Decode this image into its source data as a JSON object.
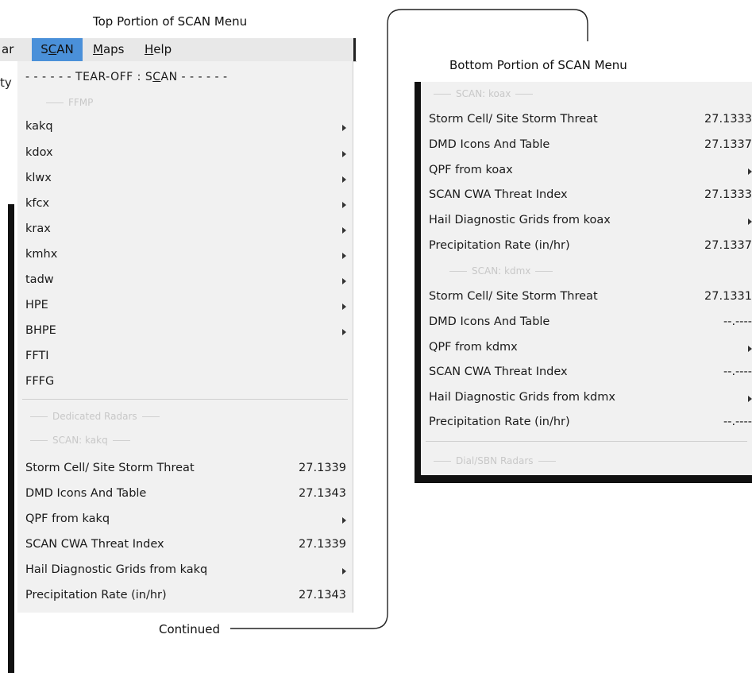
{
  "captions": {
    "top": "Top Portion of SCAN Menu",
    "bottom": "Bottom Portion of SCAN Menu",
    "continued": "Continued"
  },
  "menubar": {
    "partial": "ar",
    "scan": "SCAN",
    "maps": "Maps",
    "help": "Help"
  },
  "left_strip_text": "ty",
  "top_menu": {
    "tearoff": "- - - - - - TEAR-OFF : SCAN - - - - - -",
    "ffmp_header": "FFMP",
    "submenus": [
      {
        "label": "kakq"
      },
      {
        "label": "kdox"
      },
      {
        "label": "klwx"
      },
      {
        "label": "kfcx"
      },
      {
        "label": "krax"
      },
      {
        "label": "kmhx"
      },
      {
        "label": "tadw"
      },
      {
        "label": "HPE"
      },
      {
        "label": "BHPE"
      }
    ],
    "plain": [
      "FFTI",
      "FFFG"
    ],
    "dedicated_header": "Dedicated Radars",
    "scan_kakq_header": "SCAN: kakq",
    "items": [
      {
        "label": "Storm Cell/ Site Storm Threat",
        "value": "27.1339",
        "submenu": false
      },
      {
        "label": "DMD Icons And Table",
        "value": "27.1343",
        "submenu": false
      },
      {
        "label": "QPF from kakq",
        "value": "",
        "submenu": true
      },
      {
        "label": "SCAN CWA Threat Index",
        "value": "27.1339",
        "submenu": false
      },
      {
        "label": "Hail Diagnostic Grids from kakq",
        "value": "",
        "submenu": true
      },
      {
        "label": "Precipitation Rate (in/hr)",
        "value": "27.1343",
        "submenu": false
      }
    ]
  },
  "bottom_menu": {
    "scan_koax_header": "SCAN: koax",
    "koax_items": [
      {
        "label": "Storm Cell/ Site Storm Threat",
        "value": "27.1333",
        "submenu": false
      },
      {
        "label": "DMD Icons And Table",
        "value": "27.1337",
        "submenu": false
      },
      {
        "label": "QPF from koax",
        "value": "",
        "submenu": true
      },
      {
        "label": "SCAN CWA Threat Index",
        "value": "27.1333",
        "submenu": false
      },
      {
        "label": "Hail Diagnostic Grids from koax",
        "value": "",
        "submenu": true
      },
      {
        "label": "Precipitation Rate (in/hr)",
        "value": "27.1337",
        "submenu": false
      }
    ],
    "scan_kdmx_header": "SCAN: kdmx",
    "kdmx_items": [
      {
        "label": "Storm Cell/ Site Storm Threat",
        "value": "27.1331",
        "submenu": false
      },
      {
        "label": "DMD Icons And Table",
        "value": "--.----",
        "submenu": false
      },
      {
        "label": "QPF from kdmx",
        "value": "",
        "submenu": true
      },
      {
        "label": "SCAN CWA Threat Index",
        "value": "--.----",
        "submenu": false
      },
      {
        "label": "Hail Diagnostic Grids from kdmx",
        "value": "",
        "submenu": true
      },
      {
        "label": "Precipitation Rate (in/hr)",
        "value": "--.----",
        "submenu": false
      }
    ],
    "dial_header": "Dial/SBN Radars"
  }
}
